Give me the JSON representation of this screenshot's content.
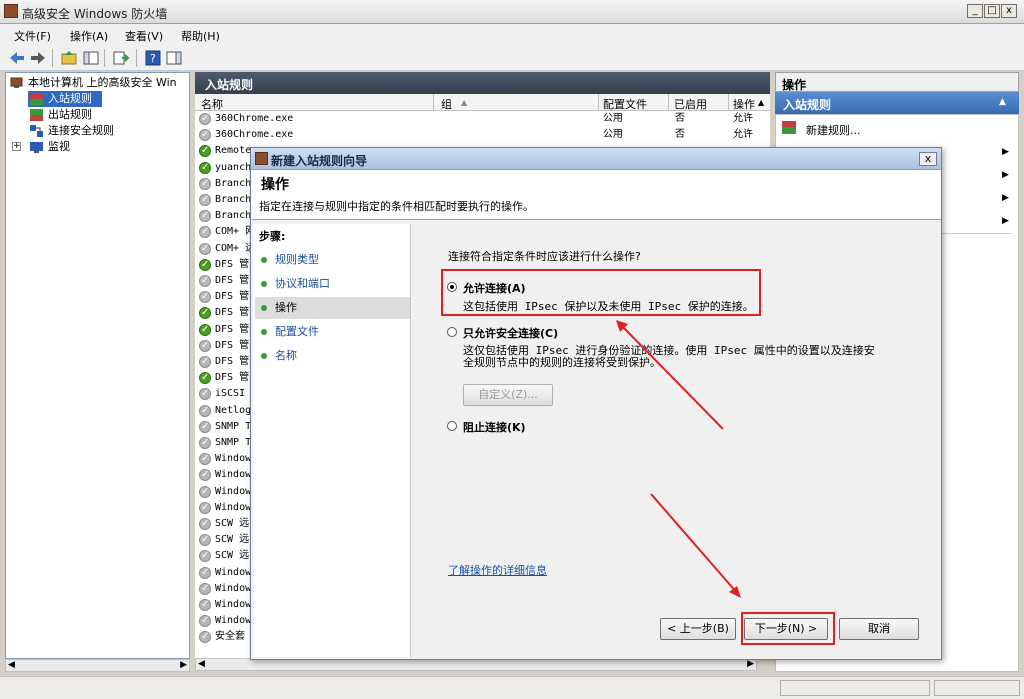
{
  "window": {
    "title": "高级安全 Windows 防火墙",
    "min_label": "_",
    "max_label": "□",
    "close_label": "x"
  },
  "menu": {
    "file": "文件(F)",
    "action": "操作(A)",
    "view": "查看(V)",
    "help": "帮助(H)"
  },
  "tree": {
    "root": "本地计算机 上的高级安全 Win",
    "items": [
      "入站规则",
      "出站规则",
      "连接安全规则",
      "监视"
    ],
    "expander": "+"
  },
  "middle": {
    "title": "入站规则",
    "columns": [
      "名称",
      "组",
      "配置文件",
      "已启用",
      "操作"
    ],
    "rows": [
      {
        "name": "360Chrome.exe",
        "profile": "公用",
        "enabled": "否",
        "action": "允许",
        "on": false
      },
      {
        "name": "360Chrome.exe",
        "profile": "公用",
        "enabled": "否",
        "action": "允许",
        "on": false
      },
      {
        "name": "Remote",
        "on": true
      },
      {
        "name": "yuanch",
        "on": true
      },
      {
        "name": "Branch",
        "on": false
      },
      {
        "name": "Branch",
        "on": false
      },
      {
        "name": "Branch",
        "on": false
      },
      {
        "name": "COM+ 网",
        "on": false
      },
      {
        "name": "COM+ 远",
        "on": false
      },
      {
        "name": "DFS 管",
        "on": true
      },
      {
        "name": "DFS 管",
        "on": false
      },
      {
        "name": "DFS 管",
        "on": false
      },
      {
        "name": "DFS 管",
        "on": true
      },
      {
        "name": "DFS 管",
        "on": true
      },
      {
        "name": "DFS 管",
        "on": false
      },
      {
        "name": "DFS 管",
        "on": false
      },
      {
        "name": "DFS 管",
        "on": true
      },
      {
        "name": "iSCSI",
        "on": false
      },
      {
        "name": "Netlog",
        "on": false
      },
      {
        "name": "SNMP T",
        "on": false
      },
      {
        "name": "SNMP T",
        "on": false
      },
      {
        "name": "Window",
        "on": false
      },
      {
        "name": "Window",
        "on": false
      },
      {
        "name": "Window",
        "on": false
      },
      {
        "name": "Window",
        "on": false
      },
      {
        "name": "SCW 远",
        "on": false
      },
      {
        "name": "SCW 远",
        "on": false
      },
      {
        "name": "SCW 远",
        "on": false
      },
      {
        "name": "Window",
        "on": false
      },
      {
        "name": "Window",
        "on": false
      },
      {
        "name": "Window",
        "on": false
      },
      {
        "name": "Window",
        "on": false
      },
      {
        "name": "安全套",
        "on": false
      }
    ]
  },
  "actions": {
    "title": "操作",
    "section": "入站规则",
    "new_rule": "新建规则..."
  },
  "dialog": {
    "title": "新建入站规则向导",
    "close": "x",
    "heading": "操作",
    "subheading": "指定在连接与规则中指定的条件相匹配时要执行的操作。",
    "steps_title": "步骤:",
    "steps": [
      "规则类型",
      "协议和端口",
      "操作",
      "配置文件",
      "名称"
    ],
    "question": "连接符合指定条件时应该进行什么操作?",
    "option_allow": "允许连接(A)",
    "option_allow_desc": "这包括使用 IPsec 保护以及未使用 IPsec 保护的连接。",
    "option_secure": "只允许安全连接(C)",
    "option_secure_desc_1": "这仅包括使用 IPsec 进行身份验证的连接。使用 IPsec 属性中的设置以及连接安",
    "option_secure_desc_2": "全规则节点中的规则的连接将受到保护。",
    "customize_btn": "自定义(Z)...",
    "option_block": "阻止连接(K)",
    "learn_more": "了解操作的详细信息",
    "back_btn": "< 上一步(B)",
    "next_btn": "下一步(N) >",
    "cancel_btn": "取消"
  }
}
